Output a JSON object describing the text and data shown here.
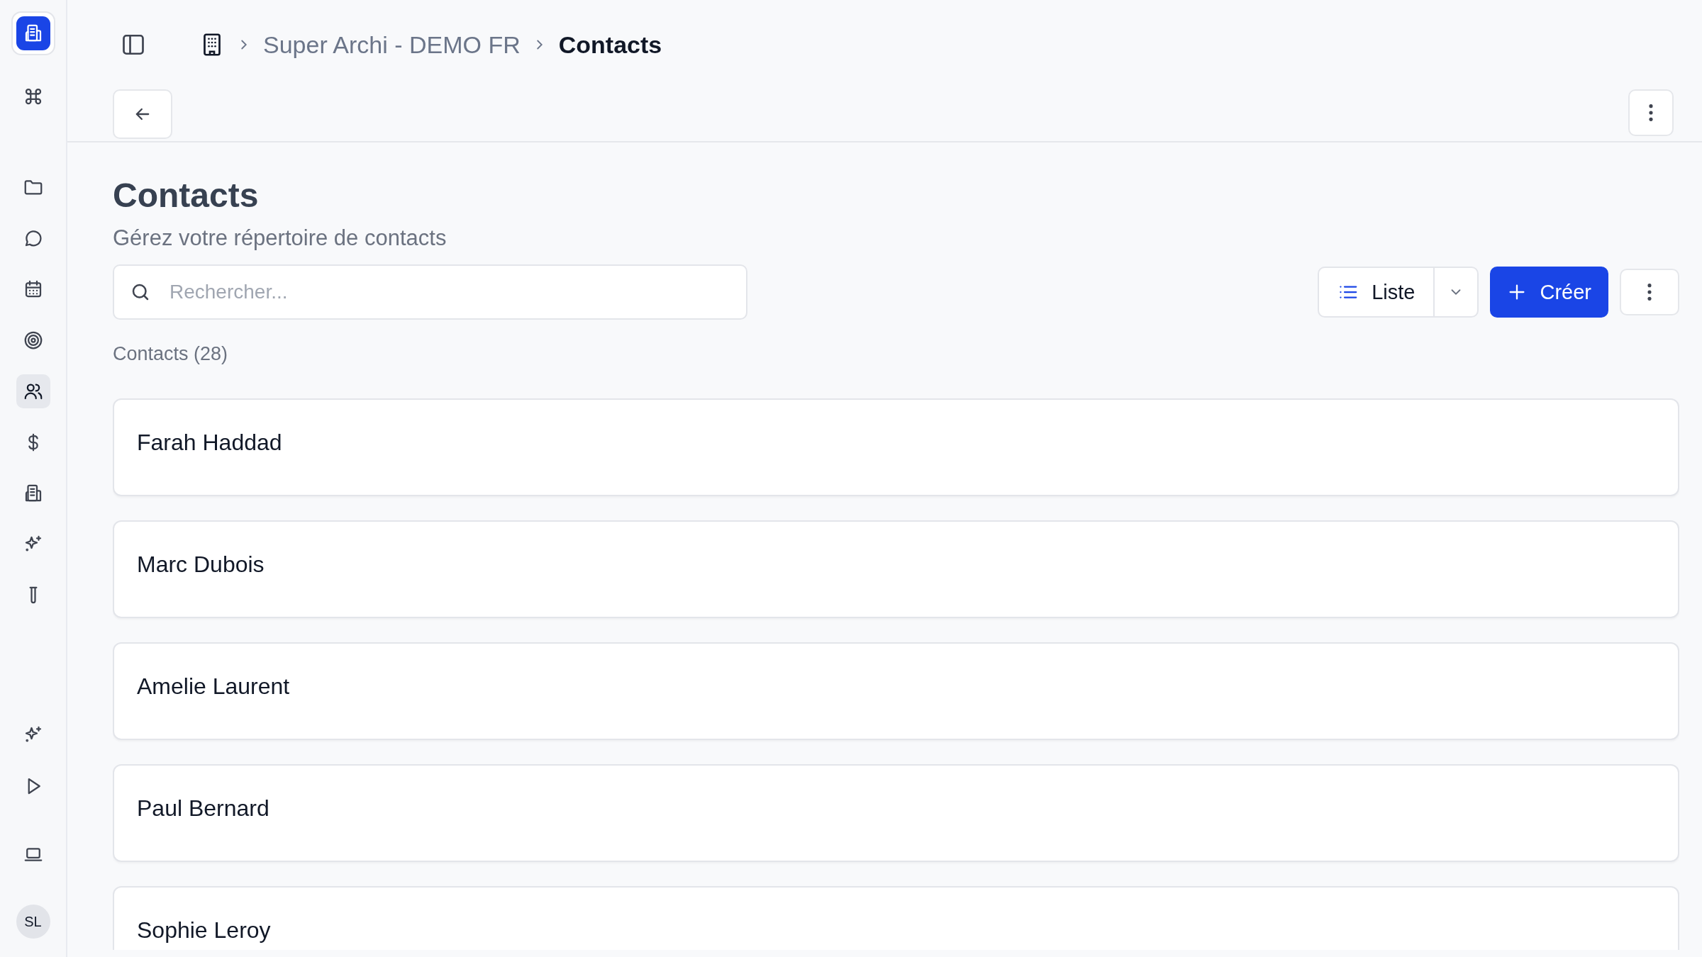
{
  "sidebar": {
    "top_items": [
      {
        "selected": false
      },
      {
        "selected": false
      },
      {
        "selected": false
      },
      {
        "selected": false
      },
      {
        "selected": false
      },
      {
        "selected": true
      },
      {
        "selected": false
      },
      {
        "selected": false
      },
      {
        "selected": false
      },
      {
        "selected": false
      }
    ],
    "bottom_items": [
      {
        "selected": false
      },
      {
        "selected": false
      },
      {
        "selected": false
      }
    ],
    "avatar": "SL"
  },
  "breadcrumb": [
    {
      "label": "Super Archi - DEMO FR",
      "current": false
    },
    {
      "label": "Contacts",
      "current": true
    }
  ],
  "page": {
    "title": "Contacts",
    "subtitle": "Gérez votre répertoire de contacts"
  },
  "search": {
    "placeholder": "Rechercher..."
  },
  "view_button": "Liste",
  "create_button": "Créer",
  "count_label": "Contacts (28)",
  "contacts": [
    {
      "name": "Farah Haddad"
    },
    {
      "name": "Marc Dubois"
    },
    {
      "name": "Amelie Laurent"
    },
    {
      "name": "Paul Bernard"
    },
    {
      "name": "Sophie Leroy"
    }
  ]
}
